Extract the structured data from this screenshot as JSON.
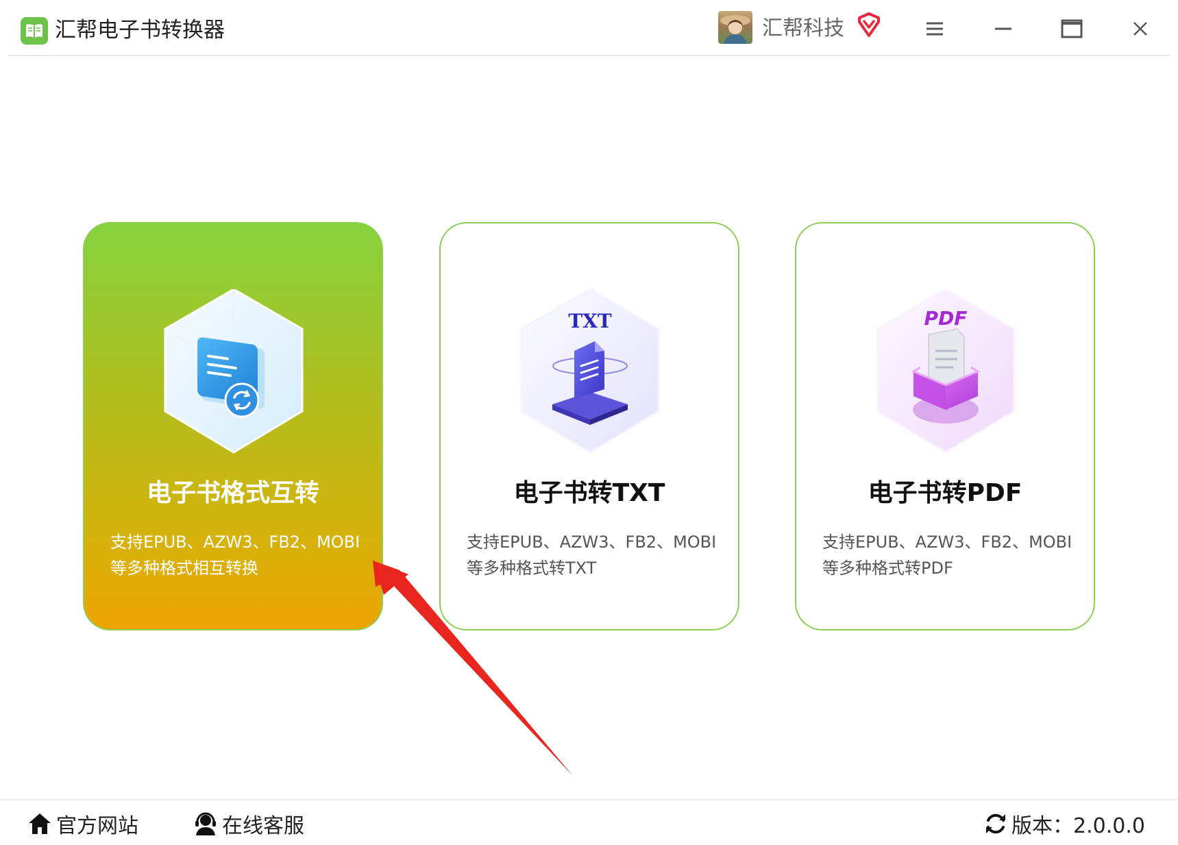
{
  "app": {
    "title": "汇帮电子书转换器",
    "logo_icon": "book-icon",
    "accent_color": "#6cc24a"
  },
  "user": {
    "name": "汇帮科技",
    "avatar_icon": "avatar-photo",
    "vip_icon": "vip-diamond-icon",
    "vip_color": "#e8283c"
  },
  "window_controls": {
    "menu_icon": "hamburger-menu-icon",
    "minimize_icon": "minimize-icon",
    "maximize_icon": "maximize-icon",
    "close_icon": "close-icon"
  },
  "cards": [
    {
      "title": "电子书格式互转",
      "desc_line1": "支持EPUB、AZW3、FB2、MOBI",
      "desc_line2": "等多种格式相互转换",
      "icon": "ebook-convert-icon",
      "selected": true
    },
    {
      "title": "电子书转TXT",
      "desc_line1": "支持EPUB、AZW3、FB2、MOBI",
      "desc_line2": "等多种格式转TXT",
      "icon_label": "TXT",
      "icon": "txt-document-icon",
      "selected": false
    },
    {
      "title": "电子书转PDF",
      "desc_line1": "支持EPUB、AZW3、FB2、MOBI",
      "desc_line2": "等多种格式转PDF",
      "icon_label": "PDF",
      "icon": "pdf-document-icon",
      "selected": false
    }
  ],
  "annotation": {
    "arrow_color": "#e8261f",
    "points_to": "电子书格式互转"
  },
  "footer": {
    "website_label": "官方网站",
    "service_label": "在线客服",
    "version_label": "版本：2.0.0.0",
    "home_icon": "home-icon",
    "service_icon": "customer-service-icon",
    "refresh_icon": "refresh-icon"
  }
}
